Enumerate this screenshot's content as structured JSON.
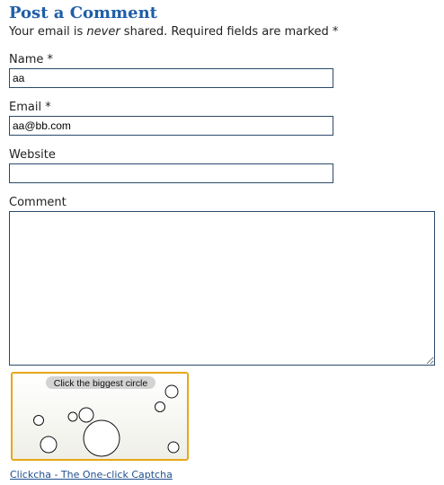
{
  "heading": "Post a Comment",
  "intro": {
    "before": "Your email is ",
    "emphasis": "never",
    "after": " shared. Required fields are marked *"
  },
  "form": {
    "name_label": "Name *",
    "name_value": "aa",
    "email_label": "Email *",
    "email_value": "aa@bb.com",
    "website_label": "Website",
    "website_value": "",
    "comment_label": "Comment",
    "comment_value": ""
  },
  "captcha": {
    "instruction": "Click the biggest circle",
    "link_text": "Clickcha - The One-click Captcha"
  },
  "colors": {
    "heading": "#1f5ea8",
    "field_border": "#2b4a6b",
    "captcha_border": "#e6a817",
    "link": "#1f4e8c"
  }
}
